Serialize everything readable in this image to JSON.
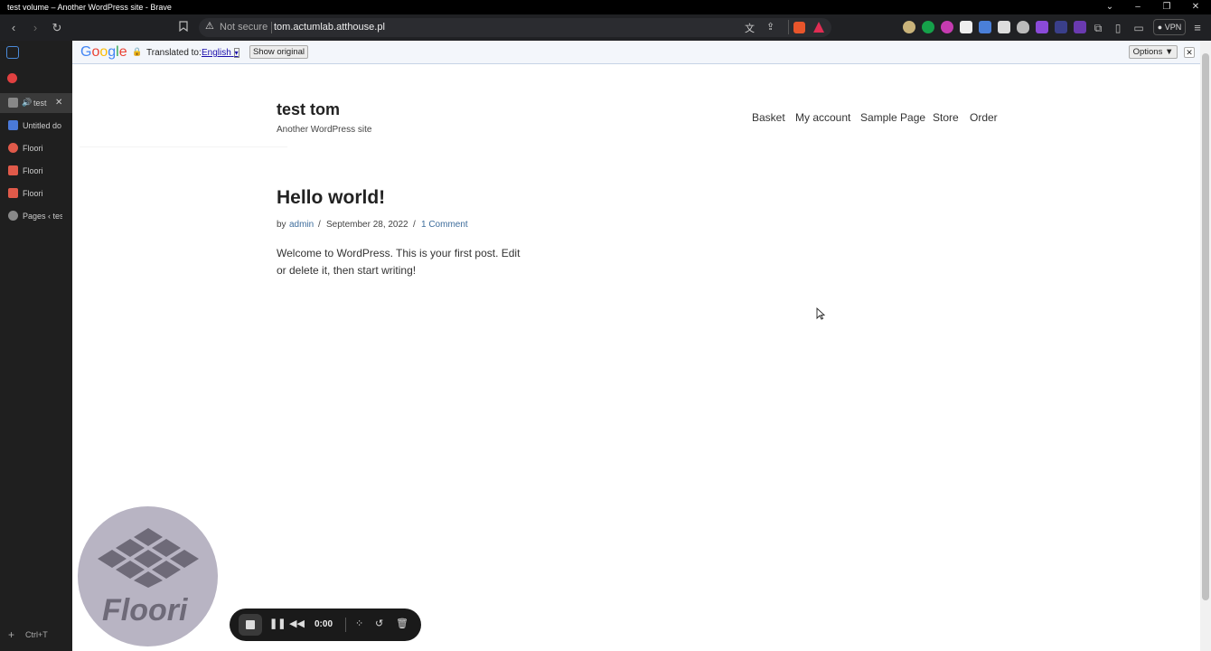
{
  "window": {
    "title": "test volume – Another WordPress site - Brave"
  },
  "toolbar": {
    "security_label": "Not secure",
    "url": "tom.actumlab.atthouse.pl",
    "vpn_label": "VPN"
  },
  "sidebar": {
    "tabs": [
      {
        "label": "test",
        "icon": "globe-icon",
        "color": "#888888"
      },
      {
        "label": "Untitled do",
        "icon": "docs-icon",
        "color": "#4a79d8"
      },
      {
        "label": "Floori",
        "icon": "floori-icon",
        "color": "#e05a4a"
      },
      {
        "label": "Floori",
        "icon": "floori-icon",
        "color": "#e05a4a"
      },
      {
        "label": "Floori",
        "icon": "floori-icon",
        "color": "#e05a4a"
      },
      {
        "label": "Pages ‹ test",
        "icon": "globe-icon",
        "color": "#888888"
      }
    ],
    "new_tab_shortcut": "Ctrl+T"
  },
  "translate_bar": {
    "brand": "Google",
    "translated_to_label": "Translated to:",
    "language": "English",
    "show_original_label": "Show original",
    "options_label": "Options ▼"
  },
  "site": {
    "title": "test tom",
    "description": "Another WordPress site",
    "nav": [
      "Basket",
      "My account",
      "Sample Page",
      "Store",
      "Order"
    ]
  },
  "post": {
    "title": "Hello world!",
    "by": "by",
    "author": "admin",
    "date": "September 28, 2022",
    "separator": "/",
    "comments": "1 Comment",
    "body": "Welcome to WordPress. This is your first post. Edit or delete it, then start writing!"
  },
  "floori": {
    "logo_text": "Floori"
  },
  "recorder": {
    "time": "0:00"
  },
  "colors": {
    "link": "#3e6d9c",
    "chrome_bg": "#202124"
  }
}
